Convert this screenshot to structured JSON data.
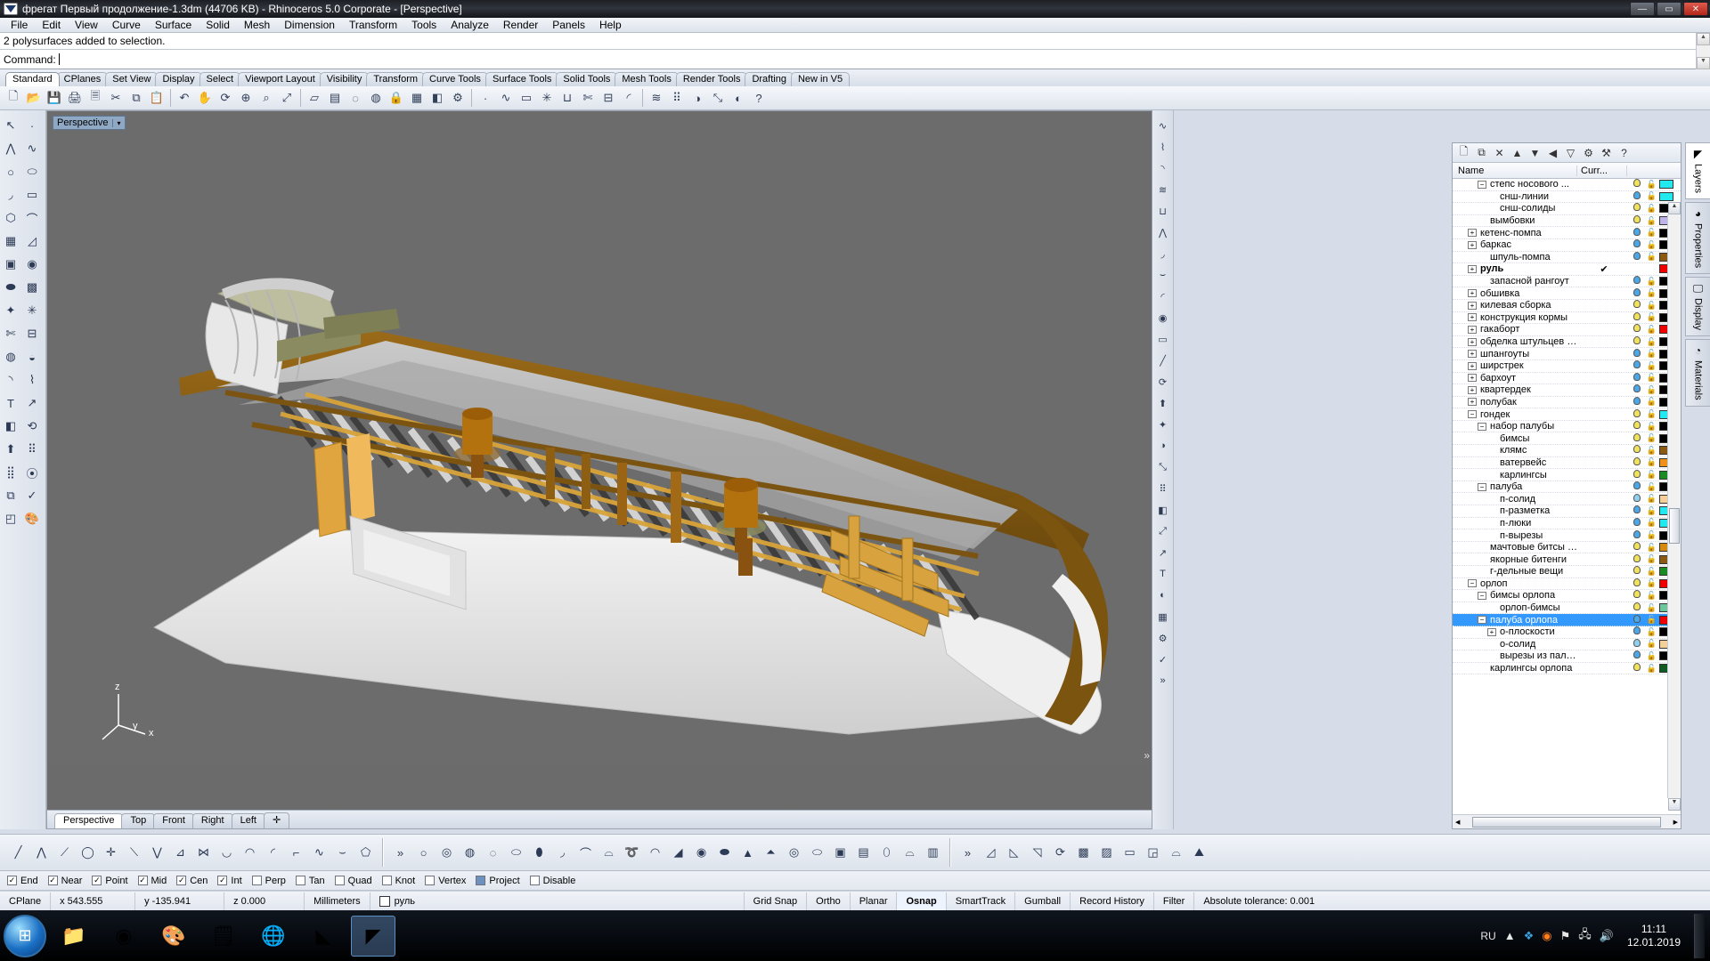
{
  "window": {
    "title": "фрегат Первый продолжение-1.3dm (44706 KB) - Rhinoceros  5.0 Corporate - [Perspective]",
    "minimize": "—",
    "maximize": "▭",
    "close": "✕"
  },
  "menu": [
    "File",
    "Edit",
    "View",
    "Curve",
    "Surface",
    "Solid",
    "Mesh",
    "Dimension",
    "Transform",
    "Tools",
    "Analyze",
    "Render",
    "Panels",
    "Help"
  ],
  "command": {
    "history": "2 polysurfaces added to selection.",
    "prompt": "Command:",
    "value": ""
  },
  "toolbar_tabs": {
    "active": "Standard",
    "items": [
      "Standard",
      "CPlanes",
      "Set View",
      "Display",
      "Select",
      "Viewport Layout",
      "Visibility",
      "Transform",
      "Curve Tools",
      "Surface Tools",
      "Solid Tools",
      "Mesh Tools",
      "Render Tools",
      "Drafting",
      "New in V5"
    ]
  },
  "main_toolbar_icons": [
    "new-file-icon",
    "open-folder-icon",
    "save-icon",
    "print-icon",
    "copy-to-clipboard-icon",
    "cut-icon",
    "copy-icon",
    "paste-icon",
    "undo-icon",
    "pan-icon",
    "rotate-view-icon",
    "zoom-in-icon",
    "zoom-window-icon",
    "zoom-extents-icon",
    "select-objects-icon",
    "select-by-layer-icon",
    "hide-objects-icon",
    "show-objects-icon",
    "lock-objects-icon",
    "layer-icon",
    "group-icon",
    "properties-icon",
    "point-icon",
    "curve-icon",
    "surface-icon",
    "explode-icon",
    "join-icon",
    "trim-icon",
    "split-icon",
    "fillet-icon",
    "offset-icon",
    "array-icon",
    "mirror-icon",
    "scale-icon",
    "render-icon",
    "help-icon"
  ],
  "left_toolbar_icons": [
    "select-arrow-icon",
    "point-icon",
    "polyline-icon",
    "curve-icon",
    "circle-icon",
    "ellipse-icon",
    "arc-icon",
    "rectangle-icon",
    "polygon-icon",
    "free-curve-icon",
    "surface-from-points-icon",
    "loft-surface-icon",
    "box-icon",
    "sphere-icon",
    "cylinder-icon",
    "surface-grid-icon",
    "boolean-union-icon",
    "explode-icon",
    "trim-icon",
    "split-icon",
    "boolean-icon",
    "boolean-difference-icon",
    "fillet-curve-icon",
    "blend-curve-icon",
    "text-icon",
    "dimension-icon",
    "group-icon",
    "rotate-icon",
    "extrude-icon",
    "array-icon",
    "array-grid-icon",
    "array-polar-icon",
    "copy-object-icon",
    "check-icon",
    "cplane-icon",
    "render-color-icon"
  ],
  "viewport": {
    "label": "Perspective",
    "dropdown_arrow": "▾",
    "axis": {
      "x": "x",
      "y": "y",
      "z": "z"
    },
    "tabs": [
      "Perspective",
      "Top",
      "Front",
      "Right",
      "Left"
    ],
    "active_tab": "Perspective",
    "add_tab": "✛",
    "background": "#6c6c6c"
  },
  "layer_panel": {
    "toolbar_icons": [
      "new-layer-icon",
      "copy-layer-icon",
      "delete-layer-icon",
      "move-up-icon",
      "move-down-icon",
      "previous-icon",
      "filter-icon",
      "properties-icon",
      "tools-icon",
      "help-icon"
    ],
    "columns": [
      "Name",
      "Curr...",
      "",
      ""
    ],
    "scroll_up": "▲",
    "scroll_down": "▼",
    "layers": [
      {
        "name": "степс носового ...",
        "indent": 2,
        "expander": "−",
        "bulb": "on-yellow",
        "lock": "unlocked",
        "color": "#22e8f0",
        "current": false
      },
      {
        "name": "снш-линии",
        "indent": 3,
        "expander": "",
        "bulb": "on-blue",
        "lock": "unlocked",
        "color": "#22e8f0",
        "current": false
      },
      {
        "name": "снш-солиды",
        "indent": 3,
        "expander": "",
        "bulb": "on-yellow",
        "lock": "unlocked",
        "color": "#000000",
        "current": false
      },
      {
        "name": "вымбовки",
        "indent": 2,
        "expander": "",
        "bulb": "on-yellow",
        "lock": "unlocked",
        "color": "#bdb4ea",
        "current": false
      },
      {
        "name": "кетенс-помпа",
        "indent": 1,
        "expander": "+",
        "bulb": "on-blue",
        "lock": "unlocked",
        "color": "#000000",
        "current": false
      },
      {
        "name": "баркас",
        "indent": 1,
        "expander": "+",
        "bulb": "on-blue",
        "lock": "unlocked",
        "color": "#000000",
        "current": false
      },
      {
        "name": "шпуль-помпа",
        "indent": 2,
        "expander": "",
        "bulb": "on-blue",
        "lock": "unlocked",
        "color": "#8a5a14",
        "current": false
      },
      {
        "name": "руль",
        "indent": 1,
        "expander": "+",
        "bulb": "none",
        "lock": "none",
        "color": "#ee0000",
        "current": true,
        "bold": true
      },
      {
        "name": "запасной рангоут",
        "indent": 2,
        "expander": "",
        "bulb": "on-blue",
        "lock": "unlocked",
        "color": "#000000",
        "current": false
      },
      {
        "name": "обшивка",
        "indent": 1,
        "expander": "+",
        "bulb": "on-blue",
        "lock": "unlocked",
        "color": "#000000",
        "current": false
      },
      {
        "name": "килевая сборка",
        "indent": 1,
        "expander": "+",
        "bulb": "on-yellow",
        "lock": "unlocked",
        "color": "#000000",
        "current": false
      },
      {
        "name": "конструкция кормы",
        "indent": 1,
        "expander": "+",
        "bulb": "on-yellow",
        "lock": "unlocked",
        "color": "#000000",
        "current": false
      },
      {
        "name": "гакаборт",
        "indent": 1,
        "expander": "+",
        "bulb": "on-yellow",
        "lock": "unlocked",
        "color": "#ee0000",
        "current": false
      },
      {
        "name": "обделка штульцев и га...",
        "indent": 1,
        "expander": "+",
        "bulb": "on-yellow",
        "lock": "unlocked",
        "color": "#000000",
        "current": false
      },
      {
        "name": "шпангоуты",
        "indent": 1,
        "expander": "+",
        "bulb": "on-blue",
        "lock": "unlocked",
        "color": "#000000",
        "current": false
      },
      {
        "name": "ширстрек",
        "indent": 1,
        "expander": "+",
        "bulb": "on-blue",
        "lock": "unlocked",
        "color": "#000000",
        "current": false
      },
      {
        "name": "бархоут",
        "indent": 1,
        "expander": "+",
        "bulb": "on-blue",
        "lock": "unlocked",
        "color": "#000000",
        "current": false
      },
      {
        "name": "квартердек",
        "indent": 1,
        "expander": "+",
        "bulb": "on-blue",
        "lock": "unlocked",
        "color": "#000000",
        "current": false
      },
      {
        "name": "полубак",
        "indent": 1,
        "expander": "+",
        "bulb": "on-blue",
        "lock": "unlocked",
        "color": "#000000",
        "current": false
      },
      {
        "name": "гондек",
        "indent": 1,
        "expander": "−",
        "bulb": "on-yellow",
        "lock": "unlocked",
        "color": "#22e8f0",
        "current": false
      },
      {
        "name": "набор палубы",
        "indent": 2,
        "expander": "−",
        "bulb": "on-yellow",
        "lock": "unlocked",
        "color": "#000000",
        "current": false
      },
      {
        "name": "бимсы",
        "indent": 3,
        "expander": "",
        "bulb": "on-yellow",
        "lock": "unlocked",
        "color": "#000000",
        "current": false
      },
      {
        "name": "клямс",
        "indent": 3,
        "expander": "",
        "bulb": "on-yellow",
        "lock": "unlocked",
        "color": "#8a5a14",
        "current": false
      },
      {
        "name": "ватервейс",
        "indent": 3,
        "expander": "",
        "bulb": "on-yellow",
        "lock": "unlocked",
        "color": "#f0921a",
        "current": false
      },
      {
        "name": "карлингсы",
        "indent": 3,
        "expander": "",
        "bulb": "on-yellow",
        "lock": "unlocked",
        "color": "#1a8a22",
        "current": false
      },
      {
        "name": "палуба",
        "indent": 2,
        "expander": "−",
        "bulb": "on-blue",
        "lock": "unlocked",
        "color": "#000000",
        "current": false
      },
      {
        "name": "п-солид",
        "indent": 3,
        "expander": "",
        "bulb": "half",
        "lock": "unlocked",
        "color": "#f5cf9a",
        "current": false
      },
      {
        "name": "п-разметка",
        "indent": 3,
        "expander": "",
        "bulb": "on-blue",
        "lock": "unlocked",
        "color": "#22e8f0",
        "current": false
      },
      {
        "name": "п-люки",
        "indent": 3,
        "expander": "",
        "bulb": "on-blue",
        "lock": "unlocked",
        "color": "#22e8f0",
        "current": false
      },
      {
        "name": "п-вырезы",
        "indent": 3,
        "expander": "",
        "bulb": "on-blue",
        "lock": "unlocked",
        "color": "#000000",
        "current": false
      },
      {
        "name": "мачтовые битсы и с...",
        "indent": 2,
        "expander": "",
        "bulb": "on-yellow",
        "lock": "unlocked",
        "color": "#d4890f",
        "current": false
      },
      {
        "name": "якорные битенги",
        "indent": 2,
        "expander": "",
        "bulb": "on-yellow",
        "lock": "unlocked",
        "color": "#8a5a14",
        "current": false
      },
      {
        "name": "г-дельные вещи",
        "indent": 2,
        "expander": "",
        "bulb": "on-yellow",
        "lock": "unlocked",
        "color": "#1a8a22",
        "current": false
      },
      {
        "name": "орлоп",
        "indent": 1,
        "expander": "−",
        "bulb": "on-yellow",
        "lock": "unlocked",
        "color": "#ee0000",
        "current": false
      },
      {
        "name": "бимсы орлопа",
        "indent": 2,
        "expander": "−",
        "bulb": "on-yellow",
        "lock": "unlocked",
        "color": "#000000",
        "current": false
      },
      {
        "name": "орлоп-бимсы",
        "indent": 3,
        "expander": "",
        "bulb": "on-yellow",
        "lock": "unlocked",
        "color": "#6ec79a",
        "current": false
      },
      {
        "name": "палуба орлопа",
        "indent": 2,
        "expander": "−",
        "bulb": "on-blue",
        "lock": "unlocked",
        "color": "#ee0000",
        "current": false,
        "selected": true
      },
      {
        "name": "о-плоскости",
        "indent": 3,
        "expander": "+",
        "bulb": "on-blue",
        "lock": "unlocked",
        "color": "#000000",
        "current": false
      },
      {
        "name": "о-солид",
        "indent": 3,
        "expander": "",
        "bulb": "half",
        "lock": "unlocked",
        "color": "#f5cf9a",
        "current": false
      },
      {
        "name": "вырезы из палубы",
        "indent": 3,
        "expander": "",
        "bulb": "on-blue",
        "lock": "unlocked",
        "color": "#000000",
        "current": false
      },
      {
        "name": "карлингсы орлопа",
        "indent": 2,
        "expander": "",
        "bulb": "on-yellow",
        "lock": "unlocked",
        "color": "#0f5c22",
        "current": false
      }
    ]
  },
  "dock_tabs": [
    {
      "label": "Layers",
      "icon": "layers-icon",
      "active": true
    },
    {
      "label": "Properties",
      "icon": "properties-color-wheel-icon",
      "active": false
    },
    {
      "label": "Display",
      "icon": "display-monitor-icon",
      "active": false
    },
    {
      "label": "Materials",
      "icon": "materials-icon",
      "active": false
    }
  ],
  "bottom_toolbar_icons": [
    "line-icon",
    "polyline-icon",
    "line-from-point-icon",
    "curve-on-sphere-icon",
    "vector-axis-icon",
    "polyline-segment-icon",
    "angle-bisector-icon",
    "angle-line-icon",
    "line-network-icon",
    "arc-center-icon",
    "arc-3point-icon",
    "arc-tangent-icon",
    "arc-vertical-icon",
    "curve-control-icon",
    "curve-interp-icon",
    "polygon-curve-icon",
    "more-chevron-icon",
    "circle-icon",
    "circle-diameter-icon",
    "circle-3point-icon",
    "circle-tangent-icon",
    "ellipse-icon",
    "ellipse-diameter-icon",
    "arc-ellipse-icon",
    "parabola-icon",
    "hyperbola-icon",
    "helix-icon",
    "spiral-icon",
    "conic-icon",
    "sphere-icon",
    "cylinder-icon",
    "cone-icon",
    "truncated-cone-icon",
    "torus-icon",
    "pipe-icon",
    "box-icon",
    "tube-icon",
    "ellipsoid-icon",
    "paraboloid-icon",
    "extrude-solid-icon",
    "more-chevron-icon",
    "loft-icon",
    "sweep1-icon",
    "sweep2-icon",
    "revolve-icon",
    "network-surface-icon",
    "patch-icon",
    "planar-surface-icon",
    "surface-corner-icon",
    "drape-icon",
    "heightfield-icon"
  ],
  "osnap": {
    "items": [
      {
        "label": "End",
        "checked": true
      },
      {
        "label": "Near",
        "checked": true
      },
      {
        "label": "Point",
        "checked": true
      },
      {
        "label": "Mid",
        "checked": true
      },
      {
        "label": "Cen",
        "checked": true
      },
      {
        "label": "Int",
        "checked": true
      },
      {
        "label": "Perp",
        "checked": false
      },
      {
        "label": "Tan",
        "checked": false
      },
      {
        "label": "Quad",
        "checked": false
      },
      {
        "label": "Knot",
        "checked": false
      },
      {
        "label": "Vertex",
        "checked": false
      },
      {
        "label": "Project",
        "checked": false,
        "filled": true
      },
      {
        "label": "Disable",
        "checked": false
      }
    ]
  },
  "statusbar": {
    "cplane": "CPlane",
    "x": "x 543.555",
    "y": "y -135.941",
    "z": "z 0.000",
    "units": "Millimeters",
    "layer": "руль",
    "layer_color": "#ffffff",
    "toggles": [
      {
        "label": "Grid Snap",
        "on": false
      },
      {
        "label": "Ortho",
        "on": false
      },
      {
        "label": "Planar",
        "on": false
      },
      {
        "label": "Osnap",
        "on": true
      },
      {
        "label": "SmartTrack",
        "on": false
      },
      {
        "label": "Gumball",
        "on": false
      },
      {
        "label": "Record History",
        "on": false
      },
      {
        "label": "Filter",
        "on": false
      }
    ],
    "tolerance": "Absolute tolerance: 0.001"
  },
  "taskbar": {
    "start": "start-orb-icon",
    "items": [
      {
        "icon": "folder-explorer-icon",
        "active": false
      },
      {
        "icon": "chrome-browser-icon",
        "active": false
      },
      {
        "icon": "paint-palette-icon",
        "active": false
      },
      {
        "icon": "calculator-icon",
        "active": false
      },
      {
        "icon": "firefox-browser-icon",
        "active": false
      },
      {
        "icon": "rhino-icon",
        "active": false
      },
      {
        "icon": "rhino-active-icon",
        "active": true
      }
    ],
    "tray": {
      "language": "RU",
      "expand": "▲",
      "icons": [
        "dropbox-icon",
        "avast-icon",
        "flag-icon",
        "network-icon",
        "volume-icon"
      ],
      "time": "11:11",
      "date": "12.01.2019"
    }
  }
}
